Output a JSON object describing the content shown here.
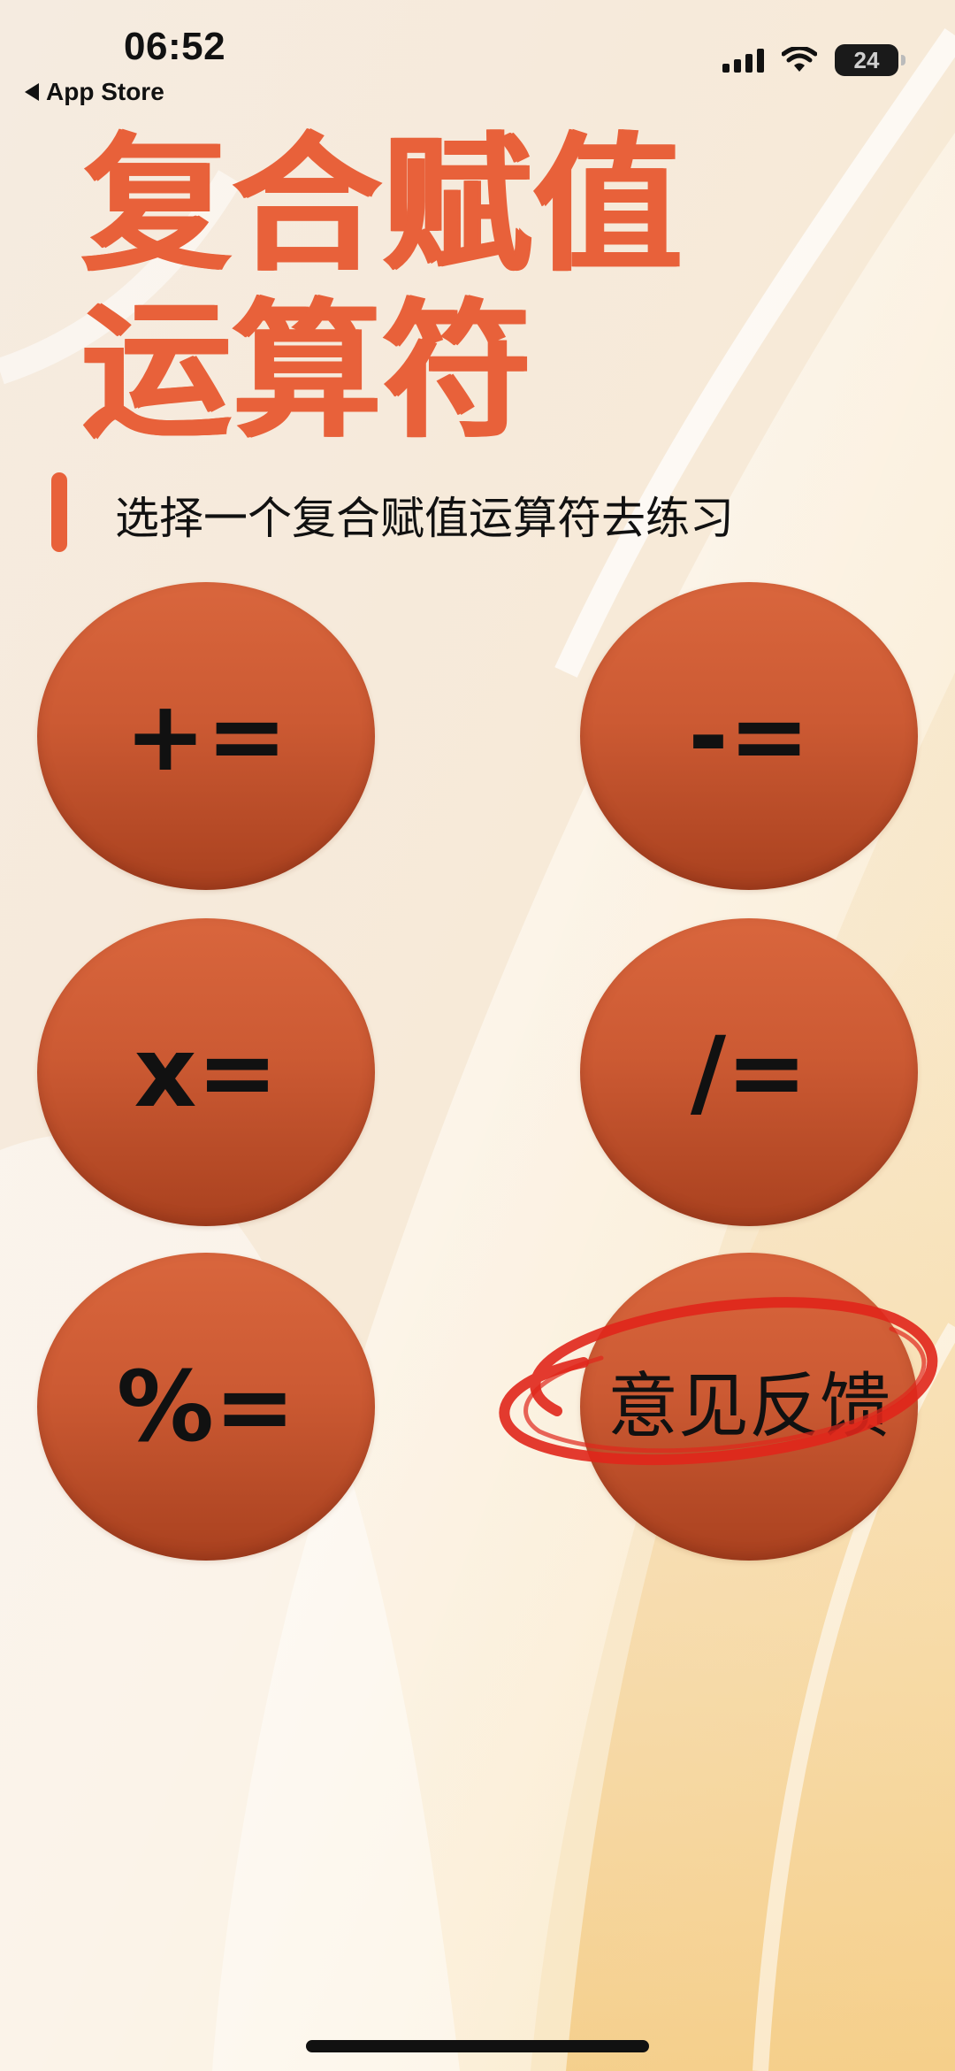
{
  "status_bar": {
    "time": "06:52",
    "back_label": "App Store",
    "battery_percent": "24",
    "battery_level": 0.24
  },
  "header": {
    "title_line1": "复合赋值",
    "title_line2": "运算符",
    "subtitle": "选择一个复合赋值运算符去练习"
  },
  "operators": [
    {
      "label": "+="
    },
    {
      "label": "-="
    },
    {
      "label": "x="
    },
    {
      "label": "/="
    },
    {
      "label": "%="
    },
    {
      "label": "意见反馈"
    }
  ],
  "colors": {
    "accent": "#e8613a",
    "button_top": "#d9663d",
    "button_bottom": "#a9411f",
    "annotation": "#e0261b"
  },
  "icons": [
    "back-triangle-icon",
    "signal-icon",
    "wifi-icon",
    "battery-icon"
  ]
}
